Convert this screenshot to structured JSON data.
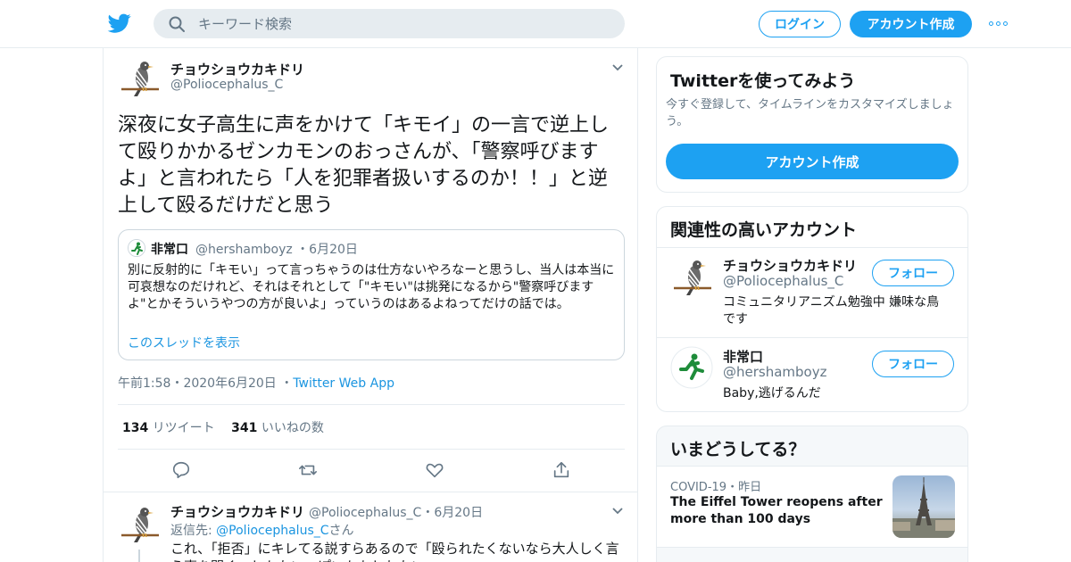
{
  "header": {
    "search_placeholder": "キーワード検索",
    "login_label": "ログイン",
    "signup_label": "アカウント作成",
    "brand_color": "#1da1f2"
  },
  "main_tweet": {
    "author_name": "チョウショウカキドリ",
    "author_handle": "@Poliocephalus_C",
    "text": "深夜に女子高生に声をかけて「キモイ」の一言で逆上して殴りかかるゼンカモンのおっさんが、「警察呼びますよ」と言われたら「人を犯罪者扱いするのか！！」と逆上して殴るだけだと思う",
    "quote": {
      "author_name": "非常口",
      "author_handle": "@hershamboyz",
      "date": "・6月20日",
      "text": "別に反射的に「キモい」って言っちゃうのは仕方ないやろなーと思うし、当人は本当に可哀想なのだけれど、それはそれとして「\"キモい\"は挑発になるから\"警察呼びますよ\"とかそういうやつの方が良いよ」っていうのはあるよねってだけの話では。",
      "show_thread": "このスレッドを表示"
    },
    "time": "午前1:58",
    "date": "・2020年6月20日",
    "app": "Twitter Web App",
    "retweet_count": "134",
    "retweet_label": "リツイート",
    "like_count": "341",
    "like_label": "いいねの数"
  },
  "reply_tweet": {
    "author_name": "チョウショウカキドリ",
    "author_handle": "@Poliocephalus_C",
    "date": "・6月20日",
    "reply_prefix": "返信先:",
    "reply_target": "@Poliocephalus_C",
    "reply_suffix": "さん",
    "text": "これ、「拒否」にキレてる説すらあるので「殴られたくないなら大人しく言う事を聞く」しかない、ぽいかもしれない"
  },
  "sidebar": {
    "signup_card": {
      "title": "Twitterを使ってみよう",
      "subtitle": "今すぐ登録して、タイムラインをカスタマイズしましょう。",
      "button": "アカウント作成"
    },
    "related_accounts": {
      "title": "関連性の高いアカウント",
      "follow_label": "フォロー",
      "accounts": [
        {
          "name": "チョウショウカキドリ",
          "handle": "@Poliocephalus_C",
          "bio": "コミュニタリアニズム勉強中 嫌味な鳥です"
        },
        {
          "name": "非常口",
          "handle": "@hershamboyz",
          "bio": "Baby,逃げるんだ"
        }
      ]
    },
    "trends": {
      "title": "いまどうしてる？",
      "items": [
        {
          "category": "COVID-19",
          "time": "・昨日",
          "headline": "The Eiffel Tower reopens after more than 100 days"
        }
      ]
    }
  }
}
